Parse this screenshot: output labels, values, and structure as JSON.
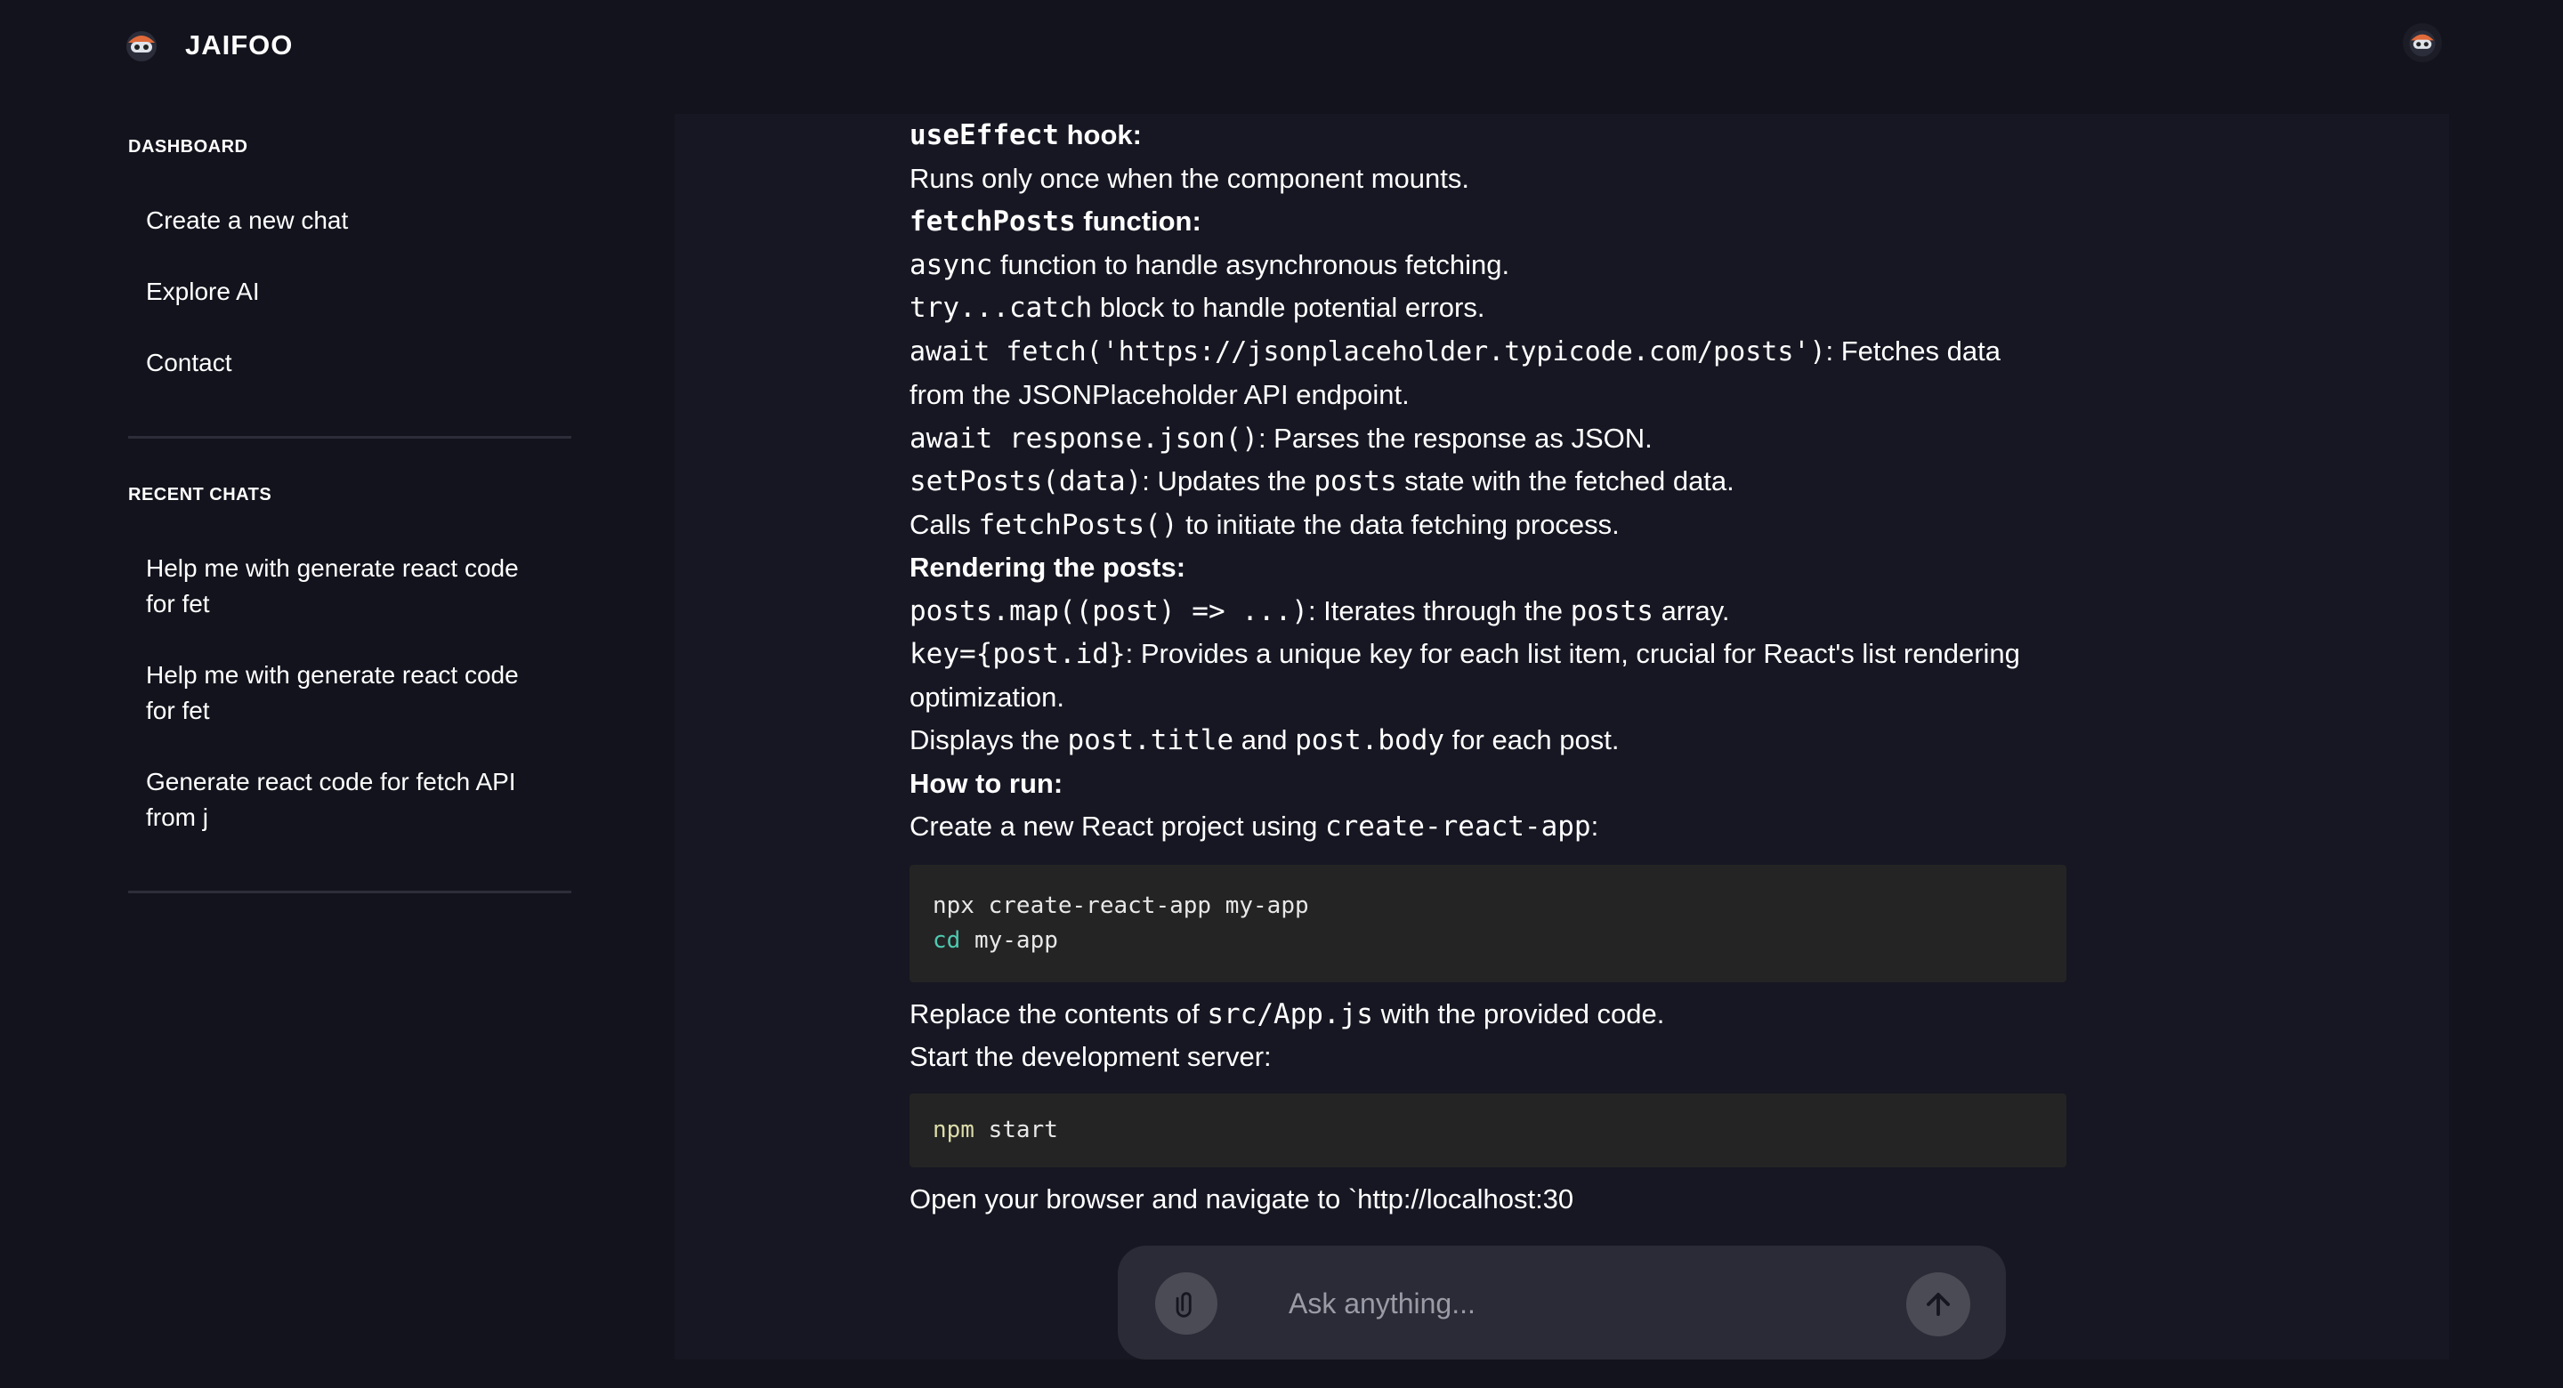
{
  "app": {
    "brand": "JAIFOO"
  },
  "sidebar": {
    "dashboard_title": "DASHBOARD",
    "nav": [
      {
        "label": "Create a new chat"
      },
      {
        "label": "Explore AI"
      },
      {
        "label": "Contact"
      }
    ],
    "recent_title": "RECENT CHATS",
    "recent": [
      {
        "label": "Help me with generate react code for fet"
      },
      {
        "label": "Help me with generate react code for fet"
      },
      {
        "label": "Generate react code for fetch API from j"
      }
    ]
  },
  "message": {
    "l1_code": "useEffect",
    "l1_text": " hook:",
    "l2": "Runs only once when the component mounts.",
    "l3_code": "fetchPosts",
    "l3_text": " function:",
    "l4_code": "async",
    "l4_text": " function to handle asynchronous fetching.",
    "l5_code": "try...catch",
    "l5_text": " block to handle potential errors.",
    "l6_code": "await fetch('https://jsonplaceholder.typicode.com/posts')",
    "l6_text": ": Fetches data",
    "l7": "from the JSONPlaceholder API endpoint.",
    "l8_code": "await response.json()",
    "l8_text": ": Parses the response as JSON.",
    "l9_code": "setPosts(data)",
    "l9_text_a": ": Updates the ",
    "l9_code2": "posts",
    "l9_text_b": " state with the fetched data.",
    "l10_text_a": "Calls ",
    "l10_code": "fetchPosts()",
    "l10_text_b": " to initiate the data fetching process.",
    "l11": "Rendering the posts:",
    "l12_code": "posts.map((post) => ...)",
    "l12_text_a": ": Iterates through the ",
    "l12_code2": "posts",
    "l12_text_b": " array.",
    "l13_code": "key={post.id}",
    "l13_text": ": Provides a unique key for each list item, crucial for React's list rendering",
    "l14": "optimization.",
    "l15_text_a": "Displays the ",
    "l15_code": "post.title",
    "l15_text_b": " and ",
    "l15_code2": "post.body",
    "l15_text_c": " for each post.",
    "l16": "How to run:",
    "l17_text": "Create a new React project using ",
    "l17_code": "create-react-app",
    "l17_text_b": ":",
    "code1_line1": "npx create-react-app my-app",
    "code1_kw": "cd",
    "code1_line2": " my-app",
    "l18_text_a": "Replace the contents of ",
    "l18_code": "src/App.js",
    "l18_text_b": " with the provided code.",
    "l19": "Start the development server:",
    "code2_kw": "npm",
    "code2_rest": " start",
    "l20": "Open your browser and navigate to `http://localhost:30"
  },
  "input": {
    "placeholder": "Ask anything..."
  }
}
